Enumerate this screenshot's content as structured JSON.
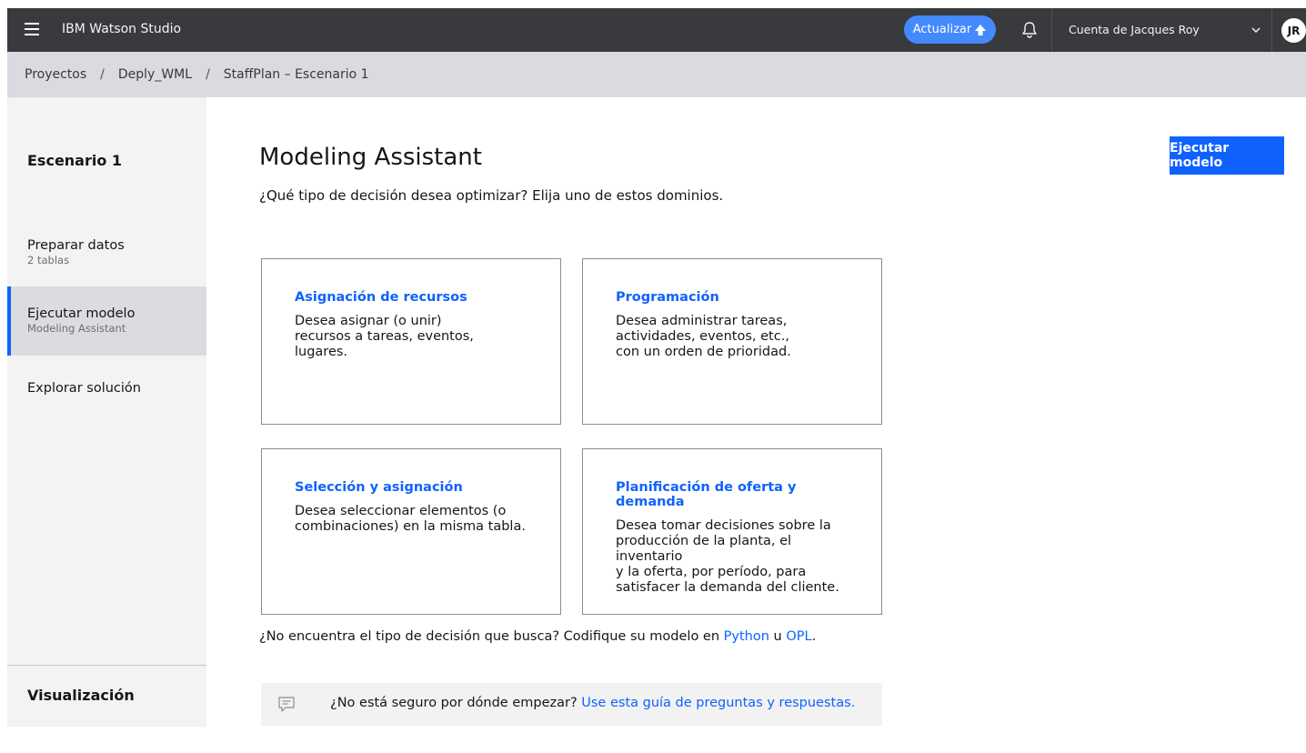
{
  "header": {
    "product_name": "IBM Watson Studio",
    "upgrade_label": "Actualizar",
    "account_label": "Cuenta de Jacques Roy",
    "avatar_initials": "JR"
  },
  "breadcrumb": [
    "Proyectos",
    "Deply_WML",
    "StaffPlan – Escenario 1"
  ],
  "sidebar": {
    "scenario_title": "Escenario 1",
    "items": [
      {
        "label": "Preparar datos",
        "sublabel": "2 tablas",
        "active": false
      },
      {
        "label": "Ejecutar modelo",
        "sublabel": "Modeling Assistant",
        "active": true
      },
      {
        "label": "Explorar solución",
        "sublabel": "",
        "active": false
      }
    ],
    "visualization_title": "Visualización"
  },
  "main": {
    "title": "Modeling Assistant",
    "run_button_label": "Ejecutar modelo",
    "subtitle": "¿Qué tipo de decisión desea optimizar? Elija uno de estos dominios.",
    "cards": [
      {
        "title": "Asignación de recursos",
        "description": "Desea asignar (o unir)\nrecursos a tareas, eventos, lugares."
      },
      {
        "title": "Programación",
        "description": "Desea administrar tareas,\nactividades, eventos, etc.,\ncon un orden de prioridad."
      },
      {
        "title": "Selección y asignación",
        "description": "Desea seleccionar elementos (o\ncombinaciones) en la misma tabla."
      },
      {
        "title": "Planificación de oferta y demanda",
        "description": "Desea tomar decisiones sobre la\nproducción de la planta, el inventario\ny la oferta, por período, para\nsatisfacer la demanda del cliente."
      }
    ],
    "hint": {
      "prefix": "¿No encuentra el tipo de decisión que busca? Codifique su modelo en ",
      "python_link": "Python",
      "middle": " u ",
      "opl_link": "OPL",
      "suffix": "."
    },
    "guide": {
      "prefix": "¿No está seguro por dónde empezar? ",
      "link": "Use esta guía de preguntas y respuestas."
    }
  },
  "icons": {
    "menu": "hamburger-menu-icon",
    "upgrade": "arrow-up-icon",
    "notifications": "bell-icon",
    "account_dropdown": "chevron-down-icon",
    "guide": "chat-icon"
  },
  "colors": {
    "topbar": "#393a3d",
    "breadcrumb_bar": "#d9dbe0",
    "primary": "#0f62fe",
    "upgrade_button": "#4589ff",
    "sidebar": "#f3f3f3",
    "sidebar_active": "#dbdcdf"
  }
}
